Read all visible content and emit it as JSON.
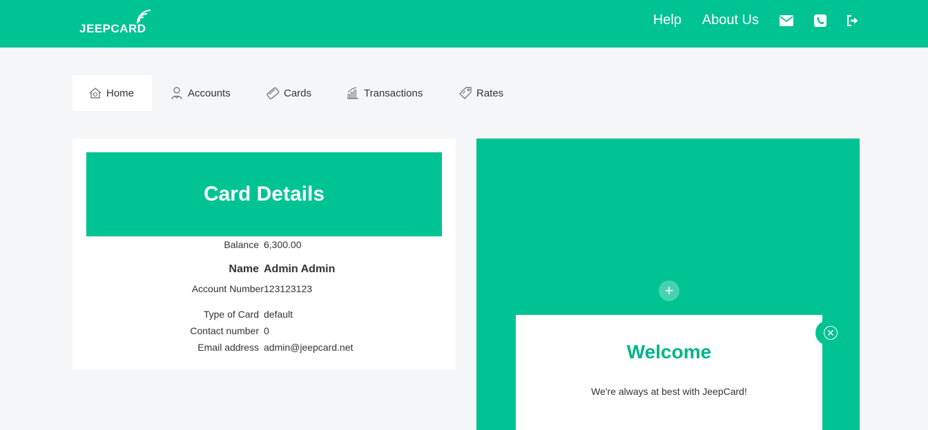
{
  "brand": {
    "name": "JEEPCARD"
  },
  "topnav": {
    "help": "Help",
    "about": "About Us",
    "icons": [
      "envelope-icon",
      "phone-icon",
      "sign-out-icon"
    ]
  },
  "tabs": [
    {
      "label": "Home",
      "icon": "home-icon",
      "active": true
    },
    {
      "label": "Accounts",
      "icon": "user-icon",
      "active": false
    },
    {
      "label": "Cards",
      "icon": "card-icon",
      "active": false
    },
    {
      "label": "Transactions",
      "icon": "chart-icon",
      "active": false
    },
    {
      "label": "Rates",
      "icon": "tag-icon",
      "active": false
    }
  ],
  "card": {
    "title": "Card Details",
    "balance_label": "Balance",
    "balance_value": "6,300.00",
    "name_label": "Name",
    "name_value": "Admin Admin",
    "account_label": "Account Number",
    "account_value": "123123123",
    "type_label": "Type of Card",
    "type_value": "default",
    "contact_label": "Contact number",
    "contact_value": "0",
    "email_label": "Email address",
    "email_value": "admin@jeepcard.net"
  },
  "promo": {
    "plus": "+",
    "title": "Welcome",
    "text": "We're always at best with JeepCard!",
    "close": "✕"
  },
  "colors": {
    "accent": "#00c393",
    "accent_text": "#00b389"
  }
}
